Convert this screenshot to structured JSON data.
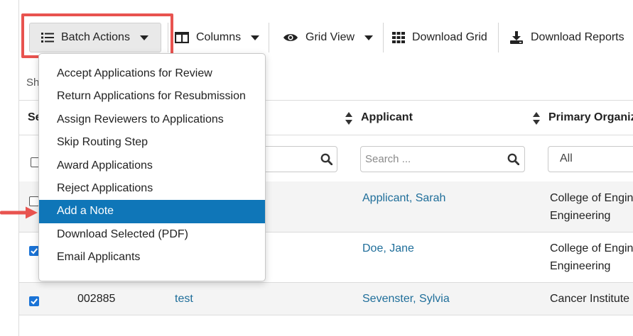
{
  "toolbar": {
    "batch_actions": "Batch Actions",
    "columns": "Columns",
    "grid_view": "Grid View",
    "download_grid": "Download Grid",
    "download_reports": "Download Reports"
  },
  "show_text": "Sh",
  "table": {
    "headers": {
      "select": "Se",
      "applicant": "Applicant",
      "primary_org": "Primary Organiz"
    },
    "filters": {
      "title_search_value": "",
      "applicant_placeholder": "Search ...",
      "primary_org_value": "All"
    },
    "rows": [
      {
        "checked": false,
        "id": "",
        "title": "",
        "applicant": "Applicant, Sarah",
        "org_line1": "College of Engin",
        "org_line2": "Engineering"
      },
      {
        "checked": true,
        "id": "",
        "title": "",
        "applicant": "Doe, Jane",
        "org_line1": "College of Engin",
        "org_line2": "Engineering"
      },
      {
        "checked": true,
        "id": "002885",
        "title": "test",
        "applicant": "Sevenster, Sylvia",
        "org_line1": "Cancer Institute",
        "org_line2": ""
      }
    ]
  },
  "batch_menu": {
    "items": [
      "Accept Applications for Review",
      "Return Applications for Resubmission",
      "Assign Reviewers to Applications",
      "Skip Routing Step",
      "Award Applications",
      "Reject Applications",
      "Add a Note",
      "Download Selected (PDF)",
      "Email Applicants"
    ],
    "active_index": 6
  },
  "colors": {
    "highlight_box": "#e8534f",
    "menu_active_bg": "#0f76b8",
    "link": "#1f6e9a",
    "checkbox_checked": "#1a73d6"
  },
  "icons": [
    "list-icon",
    "columns-icon",
    "eye-icon",
    "grid-icon",
    "download-icon",
    "sort-icon",
    "search-icon",
    "chevron-down-icon",
    "arrow-right-icon"
  ]
}
